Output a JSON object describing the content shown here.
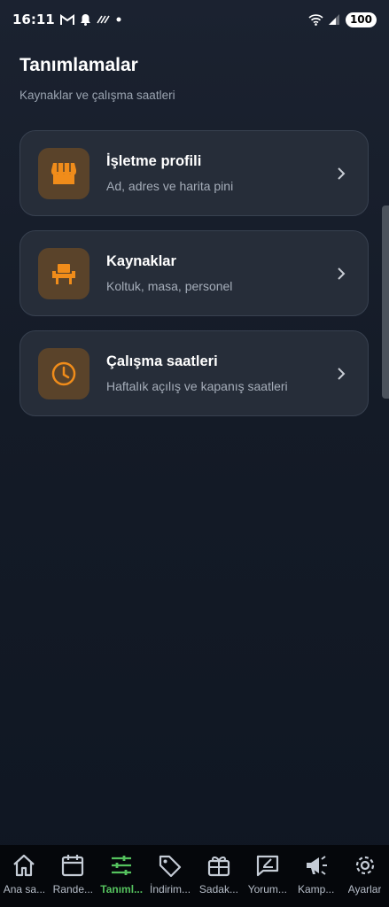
{
  "status_bar": {
    "time": "16:11",
    "battery": "100",
    "icons": [
      "gmail-icon",
      "bell-icon",
      "nfc-icon",
      "dot-icon",
      "wifi-icon",
      "signal-icon"
    ]
  },
  "header": {
    "title": "Tanımlamalar",
    "subtitle": "Kaynaklar ve çalışma saatleri"
  },
  "cards": [
    {
      "title": "İşletme profili",
      "description": "Ad, adres ve harita pini",
      "icon": "storefront-icon"
    },
    {
      "title": "Kaynaklar",
      "description": "Koltuk, masa, personel",
      "icon": "chair-icon"
    },
    {
      "title": "Çalışma saatleri",
      "description": "Haftalık açılış ve kapanış saatleri",
      "icon": "clock-icon"
    }
  ],
  "bottom_nav": {
    "items": [
      {
        "label": "Ana sa...",
        "icon": "home-icon"
      },
      {
        "label": "Rande...",
        "icon": "calendar-icon"
      },
      {
        "label": "Tanıml...",
        "icon": "sliders-icon",
        "active": true
      },
      {
        "label": "İndirim...",
        "icon": "tag-icon"
      },
      {
        "label": "Sadak...",
        "icon": "gift-card-icon"
      },
      {
        "label": "Yorum...",
        "icon": "review-icon"
      },
      {
        "label": "Kamp...",
        "icon": "megaphone-icon"
      },
      {
        "label": "Ayarlar",
        "icon": "gear-icon"
      }
    ]
  },
  "colors": {
    "background": "#141b27",
    "card": "#262d39",
    "icon_bg": "#5a432a",
    "accent": "#f08c1a",
    "nav_active": "#55c25e"
  }
}
